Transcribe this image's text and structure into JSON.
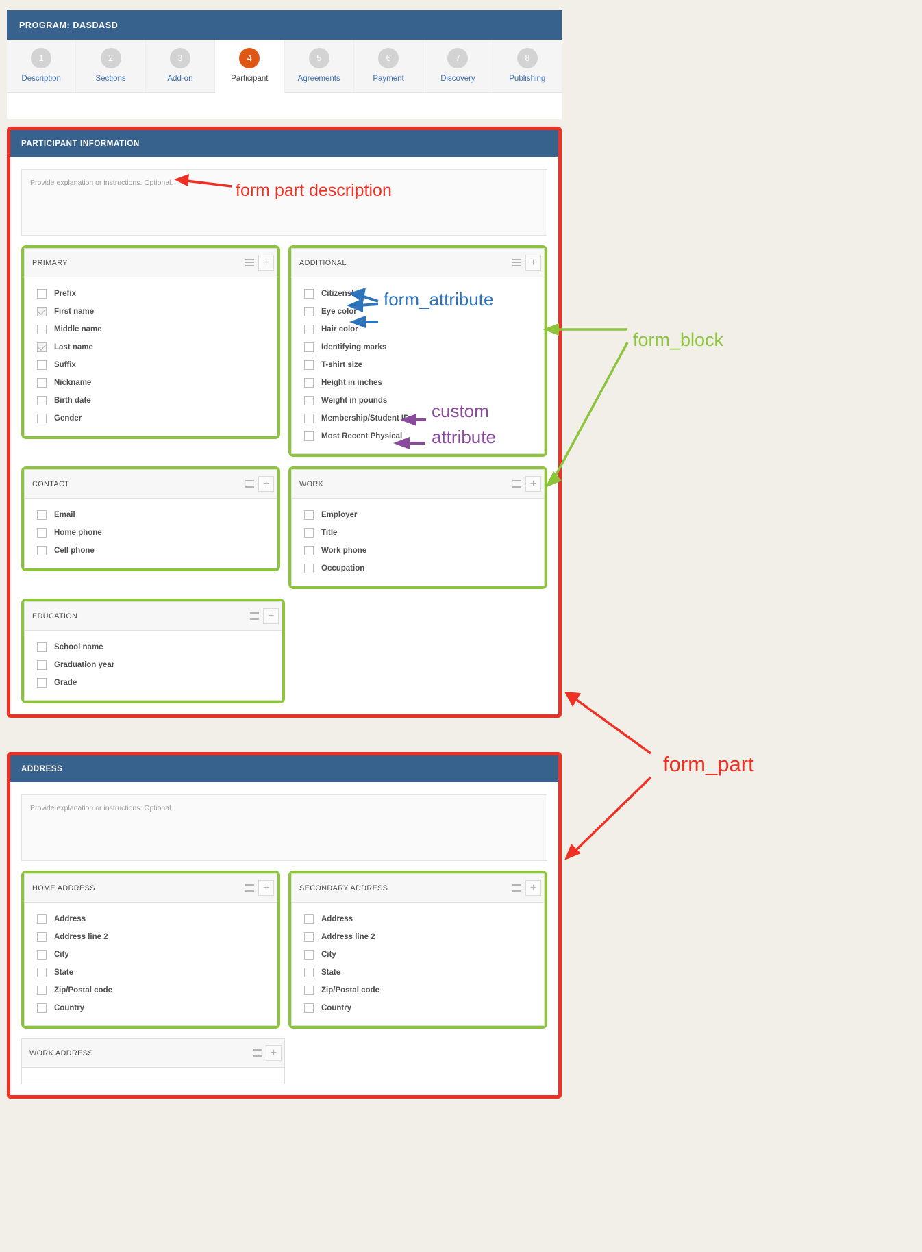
{
  "header": {
    "program_title": "PROGRAM: DASDASD",
    "tabs": [
      {
        "num": "1",
        "label": "Description",
        "active": false
      },
      {
        "num": "2",
        "label": "Sections",
        "active": false
      },
      {
        "num": "3",
        "label": "Add-on",
        "active": false
      },
      {
        "num": "4",
        "label": "Participant",
        "active": true
      },
      {
        "num": "5",
        "label": "Agreements",
        "active": false
      },
      {
        "num": "6",
        "label": "Payment",
        "active": false
      },
      {
        "num": "7",
        "label": "Discovery",
        "active": false
      },
      {
        "num": "8",
        "label": "Publishing",
        "active": false
      }
    ]
  },
  "parts": [
    {
      "title": "PARTICIPANT INFORMATION",
      "description_placeholder": "Provide explanation or instructions. Optional.",
      "rows": [
        [
          {
            "title": "PRIMARY",
            "highlighted": true,
            "attributes": [
              {
                "label": "Prefix",
                "checked": false
              },
              {
                "label": "First name",
                "checked": true
              },
              {
                "label": "Middle name",
                "checked": false
              },
              {
                "label": "Last name",
                "checked": true
              },
              {
                "label": "Suffix",
                "checked": false
              },
              {
                "label": "Nickname",
                "checked": false
              },
              {
                "label": "Birth date",
                "checked": false
              },
              {
                "label": "Gender",
                "checked": false
              }
            ]
          },
          {
            "title": "ADDITIONAL",
            "highlighted": true,
            "attributes": [
              {
                "label": "Citizenship",
                "checked": false
              },
              {
                "label": "Eye color",
                "checked": false
              },
              {
                "label": "Hair color",
                "checked": false
              },
              {
                "label": "Identifying marks",
                "checked": false
              },
              {
                "label": "T-shirt size",
                "checked": false
              },
              {
                "label": "Height in inches",
                "checked": false
              },
              {
                "label": "Weight in pounds",
                "checked": false
              },
              {
                "label": "Membership/Student ID",
                "checked": false
              },
              {
                "label": "Most Recent Physical",
                "checked": false
              }
            ]
          }
        ],
        [
          {
            "title": "CONTACT",
            "highlighted": true,
            "attributes": [
              {
                "label": "Email",
                "checked": false
              },
              {
                "label": "Home phone",
                "checked": false
              },
              {
                "label": "Cell phone",
                "checked": false
              }
            ]
          },
          {
            "title": "WORK",
            "highlighted": true,
            "attributes": [
              {
                "label": "Employer",
                "checked": false
              },
              {
                "label": "Title",
                "checked": false
              },
              {
                "label": "Work phone",
                "checked": false
              },
              {
                "label": "Occupation",
                "checked": false
              }
            ]
          }
        ],
        [
          {
            "title": "EDUCATION",
            "highlighted": true,
            "attributes": [
              {
                "label": "School name",
                "checked": false
              },
              {
                "label": "Graduation year",
                "checked": false
              },
              {
                "label": "Grade",
                "checked": false
              }
            ]
          }
        ]
      ]
    },
    {
      "title": "ADDRESS",
      "description_placeholder": "Provide explanation or instructions. Optional.",
      "rows": [
        [
          {
            "title": "HOME ADDRESS",
            "highlighted": true,
            "attributes": [
              {
                "label": "Address",
                "checked": false
              },
              {
                "label": "Address line 2",
                "checked": false
              },
              {
                "label": "City",
                "checked": false
              },
              {
                "label": "State",
                "checked": false
              },
              {
                "label": "Zip/Postal code",
                "checked": false
              },
              {
                "label": "Country",
                "checked": false
              }
            ]
          },
          {
            "title": "SECONDARY ADDRESS",
            "highlighted": true,
            "attributes": [
              {
                "label": "Address",
                "checked": false
              },
              {
                "label": "Address line 2",
                "checked": false
              },
              {
                "label": "City",
                "checked": false
              },
              {
                "label": "State",
                "checked": false
              },
              {
                "label": "Zip/Postal code",
                "checked": false
              },
              {
                "label": "Country",
                "checked": false
              }
            ]
          }
        ],
        [
          {
            "title": "WORK ADDRESS",
            "highlighted": false,
            "attributes": []
          }
        ]
      ]
    }
  ],
  "annotations": {
    "form_part_description": "form part description",
    "form_block": "form_block",
    "form_attribute": "form_attribute",
    "custom_attribute_line1": "custom",
    "custom_attribute_line2": "attribute",
    "form_part": "form_part"
  },
  "colors": {
    "part_outline": "#ee3124",
    "block_outline": "#8cc43c",
    "header_blue": "#37628d",
    "active_tab": "#df5715",
    "attribute_arrow": "#2d74bb",
    "custom_arrow": "#8a4b9c",
    "page_background": "#f2efe9"
  }
}
